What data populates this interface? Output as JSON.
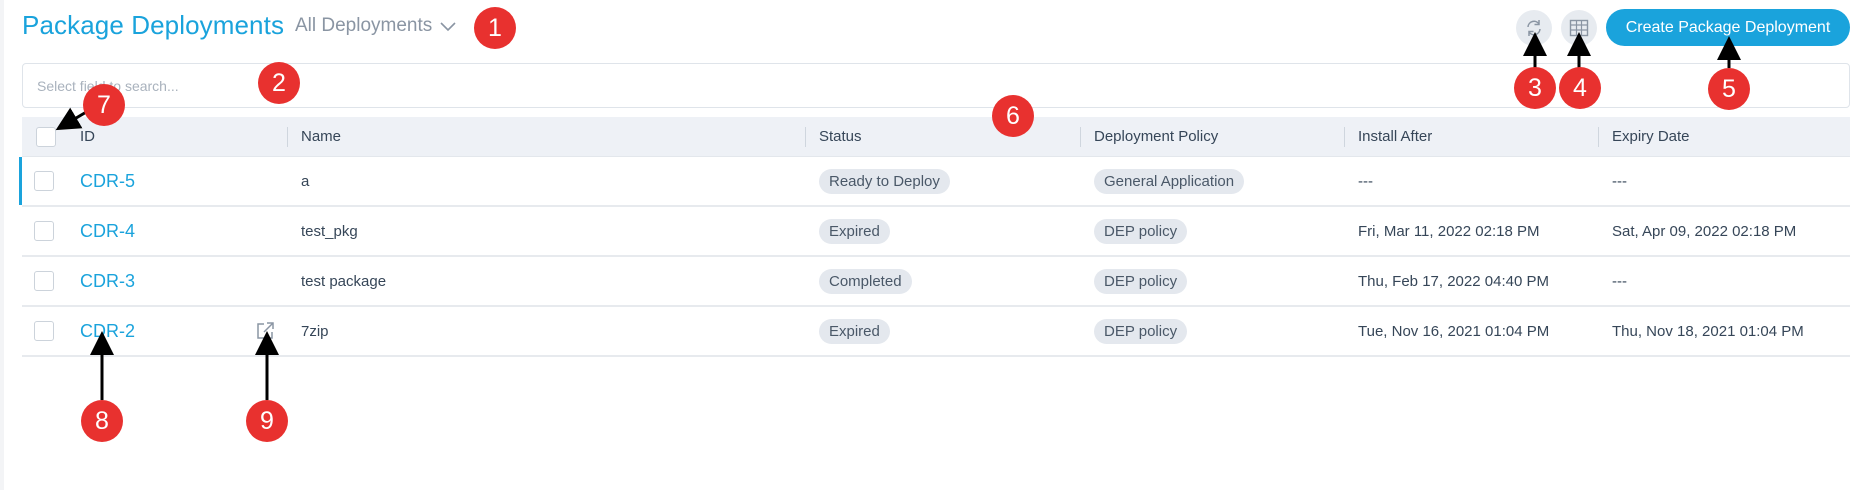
{
  "header": {
    "title": "Package Deployments",
    "view_selector": "All Deployments",
    "refresh_icon": "refresh-icon",
    "columns_icon": "table-columns-icon",
    "create_button": "Create Package Deployment"
  },
  "search": {
    "placeholder": "Select field to search..."
  },
  "table": {
    "columns": [
      "ID",
      "Name",
      "Status",
      "Deployment Policy",
      "Install After",
      "Expiry Date"
    ],
    "rows": [
      {
        "id": "CDR-5",
        "name": "a",
        "status": "Ready to Deploy",
        "policy": "General Application",
        "install_after": "---",
        "expiry": "---"
      },
      {
        "id": "CDR-4",
        "name": "test_pkg",
        "status": "Expired",
        "policy": "DEP policy",
        "install_after": "Fri, Mar 11, 2022 02:18 PM",
        "expiry": "Sat, Apr 09, 2022 02:18 PM"
      },
      {
        "id": "CDR-3",
        "name": "test package",
        "status": "Completed",
        "policy": "DEP policy",
        "install_after": "Thu, Feb 17, 2022 04:40 PM",
        "expiry": "---"
      },
      {
        "id": "CDR-2",
        "name": "7zip",
        "status": "Expired",
        "policy": "DEP policy",
        "install_after": "Tue, Nov 16, 2021 01:04 PM",
        "expiry": "Thu, Nov 18, 2021 01:04 PM"
      }
    ]
  },
  "annotations": [
    "1",
    "2",
    "3",
    "4",
    "5",
    "6",
    "7",
    "8",
    "9"
  ],
  "colors": {
    "accent": "#1aa3dc",
    "marker": "#e8312f",
    "header_bg": "#eef1f6",
    "pill_bg": "#e4e8ee"
  }
}
